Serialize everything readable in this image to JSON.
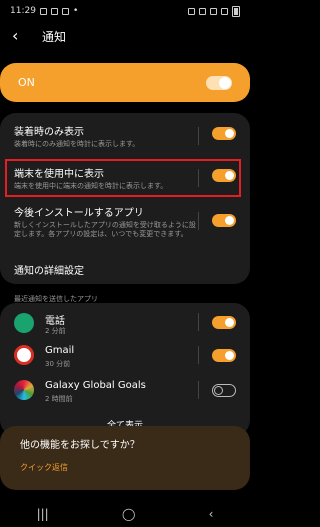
{
  "status": {
    "time": "11:29"
  },
  "header": {
    "title": "通知"
  },
  "master": {
    "label": "ON"
  },
  "settings": [
    {
      "title": "装着時のみ表示",
      "sub": "装着時にのみ通知を時計に表示します。"
    },
    {
      "title": "端末を使用中に表示",
      "sub": "端末を使用中に端末の通知を時計に表示します。"
    },
    {
      "title": "今後インストールするアプリ",
      "sub": "新しくインストールしたアプリの通知を受け取るように設定します。各アプリの設定は、いつでも変更できます。"
    },
    {
      "title": "通知の詳細設定"
    }
  ],
  "recent": {
    "label": "最近通知を送信したアプリ",
    "apps": [
      {
        "name": "電話",
        "time": "2 分前"
      },
      {
        "name": "Gmail",
        "time": "30 分前"
      },
      {
        "name": "Galaxy Global Goals",
        "time": "2 時間前"
      }
    ],
    "show_all": "全て表示"
  },
  "more": {
    "title": "他の機能をお探しですか？",
    "link": "クイック返信"
  },
  "colors": {
    "accent": "#f5a02c",
    "highlight": "#e51e24"
  }
}
